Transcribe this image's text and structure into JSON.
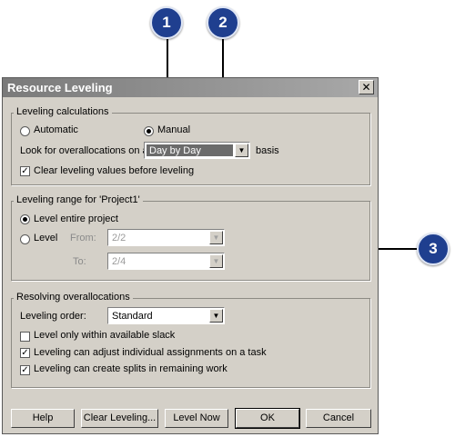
{
  "callouts": [
    "1",
    "2",
    "3"
  ],
  "dialog": {
    "title": "Resource Leveling",
    "close_glyph": "✕",
    "leveling_calculations": {
      "label": "Leveling calculations",
      "automatic_label": "Automatic",
      "manual_label": "Manual",
      "look_for_label": "Look for overallocations on a",
      "basis_value": "Day by Day",
      "basis_suffix": "basis",
      "clear_values_label": "Clear leveling values before leveling"
    },
    "leveling_range": {
      "label": "Leveling range for 'Project1'",
      "entire_project_label": "Level entire project",
      "level_label": "Level",
      "from_label": "From:",
      "from_value": "2/2",
      "to_label": "To:",
      "to_value": "2/4"
    },
    "resolving": {
      "label": "Resolving overallocations",
      "order_label": "Leveling order:",
      "order_value": "Standard",
      "slack_label": "Level only within available slack",
      "adjust_label": "Leveling can adjust individual assignments on a task",
      "splits_label": "Leveling can create splits in remaining work"
    },
    "buttons": {
      "help": "Help",
      "clear_leveling": "Clear Leveling...",
      "level_now": "Level Now",
      "ok": "OK",
      "cancel": "Cancel"
    },
    "state": {
      "automatic": false,
      "manual": true,
      "clear_values": true,
      "entire_project": true,
      "level_range": false,
      "slack": false,
      "adjust": true,
      "splits": true
    }
  }
}
